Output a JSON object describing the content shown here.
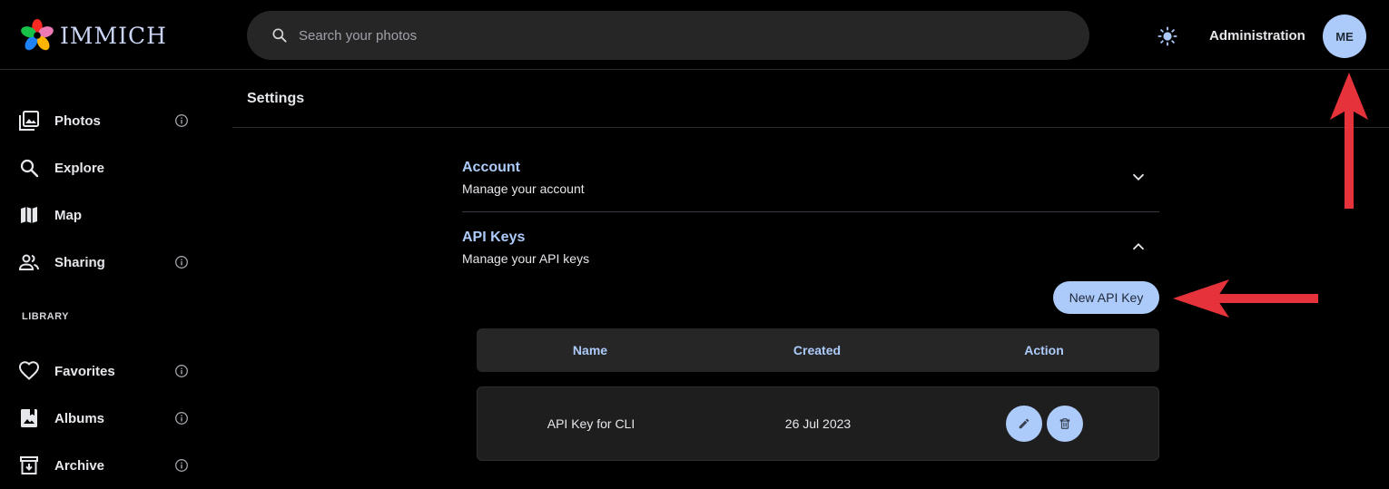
{
  "header": {
    "app_name": "IMMICH",
    "search_placeholder": "Search your photos",
    "admin_label": "Administration",
    "avatar_initials": "ME"
  },
  "sidebar": {
    "items": [
      {
        "label": "Photos",
        "icon": "photos-icon",
        "info": true
      },
      {
        "label": "Explore",
        "icon": "search-icon",
        "info": false
      },
      {
        "label": "Map",
        "icon": "map-icon",
        "info": false
      },
      {
        "label": "Sharing",
        "icon": "people-icon",
        "info": true
      }
    ],
    "library_label": "LIBRARY",
    "library_items": [
      {
        "label": "Favorites",
        "icon": "heart-icon",
        "info": true
      },
      {
        "label": "Albums",
        "icon": "album-icon",
        "info": true
      },
      {
        "label": "Archive",
        "icon": "archive-icon",
        "info": true
      }
    ]
  },
  "page": {
    "title": "Settings"
  },
  "settings": {
    "account": {
      "title": "Account",
      "subtitle": "Manage your account"
    },
    "api_keys": {
      "title": "API Keys",
      "subtitle": "Manage your API keys",
      "new_button": "New API Key"
    }
  },
  "table": {
    "headers": [
      "Name",
      "Created",
      "Action"
    ],
    "rows": [
      {
        "name": "API Key for CLI",
        "created": "26 Jul 2023"
      }
    ]
  },
  "colors": {
    "accent": "#adcbfa",
    "annotation_arrow": "#e5323b"
  }
}
